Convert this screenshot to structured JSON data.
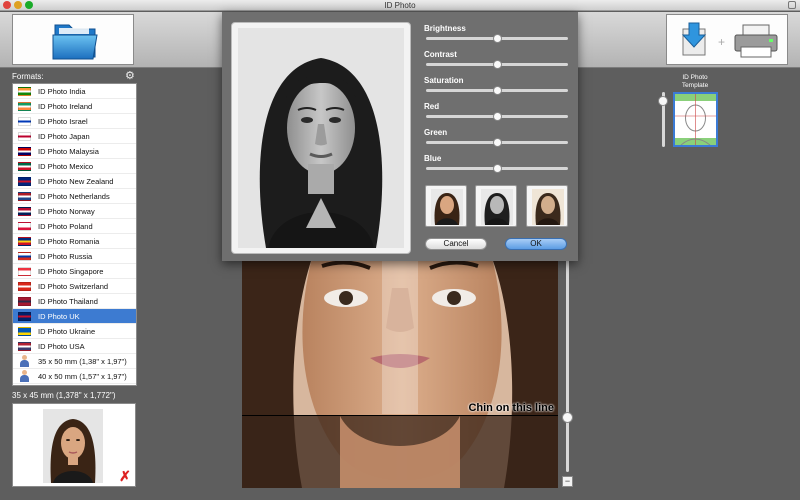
{
  "window": {
    "title": "ID Photo"
  },
  "sidebar": {
    "formats_label": "Formats:",
    "items": [
      {
        "label": "ID Photo India",
        "icon": "flag-india-icon",
        "colors": [
          "#ff9933",
          "#ffffff",
          "#138808"
        ]
      },
      {
        "label": "ID Photo Ireland",
        "icon": "flag-ireland-icon",
        "colors": [
          "#169b62",
          "#ffffff",
          "#ff883e"
        ]
      },
      {
        "label": "ID Photo Israel",
        "icon": "flag-israel-icon",
        "colors": [
          "#ffffff",
          "#0038b8",
          "#ffffff"
        ]
      },
      {
        "label": "ID Photo Japan",
        "icon": "flag-japan-icon",
        "colors": [
          "#ffffff",
          "#bc002d",
          "#ffffff"
        ]
      },
      {
        "label": "ID Photo Malaysia",
        "icon": "flag-malaysia-icon",
        "colors": [
          "#cc0001",
          "#ffffff",
          "#010066"
        ]
      },
      {
        "label": "ID Photo Mexico",
        "icon": "flag-mexico-icon",
        "colors": [
          "#006847",
          "#ffffff",
          "#ce1126"
        ]
      },
      {
        "label": "ID Photo New Zealand",
        "icon": "flag-new-zealand-icon",
        "colors": [
          "#00247d",
          "#cc142b",
          "#00247d"
        ]
      },
      {
        "label": "ID Photo Netherlands",
        "icon": "flag-netherlands-icon",
        "colors": [
          "#ae1c28",
          "#ffffff",
          "#21468b"
        ]
      },
      {
        "label": "ID Photo Norway",
        "icon": "flag-norway-icon",
        "colors": [
          "#ba0c2f",
          "#ffffff",
          "#00205b"
        ]
      },
      {
        "label": "ID Photo Poland",
        "icon": "flag-poland-icon",
        "colors": [
          "#ffffff",
          "#ffffff",
          "#dc143c"
        ]
      },
      {
        "label": "ID Photo Romania",
        "icon": "flag-romania-icon",
        "colors": [
          "#002b7f",
          "#fcd116",
          "#ce1126"
        ]
      },
      {
        "label": "ID Photo Russia",
        "icon": "flag-russia-icon",
        "colors": [
          "#ffffff",
          "#0039a6",
          "#d52b1e"
        ]
      },
      {
        "label": "ID Photo Singapore",
        "icon": "flag-singapore-icon",
        "colors": [
          "#ef3340",
          "#ffffff",
          "#ffffff"
        ]
      },
      {
        "label": "ID Photo Switzerland",
        "icon": "flag-switzerland-icon",
        "colors": [
          "#da291c",
          "#ffffff",
          "#da291c"
        ]
      },
      {
        "label": "ID Photo Thailand",
        "icon": "flag-thailand-icon",
        "colors": [
          "#a51931",
          "#2d2a4a",
          "#a51931"
        ]
      },
      {
        "label": "ID Photo UK",
        "icon": "flag-uk-icon",
        "colors": [
          "#012169",
          "#c8102e",
          "#012169"
        ],
        "selected": true
      },
      {
        "label": "ID Photo Ukraine",
        "icon": "flag-ukraine-icon",
        "colors": [
          "#0057b7",
          "#0057b7",
          "#ffd700"
        ]
      },
      {
        "label": "ID Photo USA",
        "icon": "flag-usa-icon",
        "colors": [
          "#b22234",
          "#ffffff",
          "#3c3b6e"
        ]
      },
      {
        "label": "35 x 50 mm (1,38\" x 1,97\")",
        "icon": "person-icon"
      },
      {
        "label": "40 x 50 mm (1,57\" x 1,97\")",
        "icon": "person-icon"
      }
    ],
    "current_size": "35 x 45 mm (1,378\" x 1,772\")"
  },
  "template": {
    "label_line1": "ID Photo",
    "label_line2": "Template"
  },
  "main": {
    "chin_label": "Chin on this line"
  },
  "adjustments": {
    "sliders": [
      {
        "label": "Brightness",
        "value": 0.5
      },
      {
        "label": "Contrast",
        "value": 0.5
      },
      {
        "label": "Saturation",
        "value": 0.5
      },
      {
        "label": "Red",
        "value": 0.5
      },
      {
        "label": "Green",
        "value": 0.5
      },
      {
        "label": "Blue",
        "value": 0.5
      }
    ],
    "presets": [
      "color-preset",
      "grayscale-preset",
      "sepia-preset"
    ],
    "cancel_label": "Cancel",
    "ok_label": "OK"
  },
  "colors": {
    "selection": "#3d7bd1",
    "background": "#5e5e5e",
    "ok_button": "#5c9de4"
  }
}
